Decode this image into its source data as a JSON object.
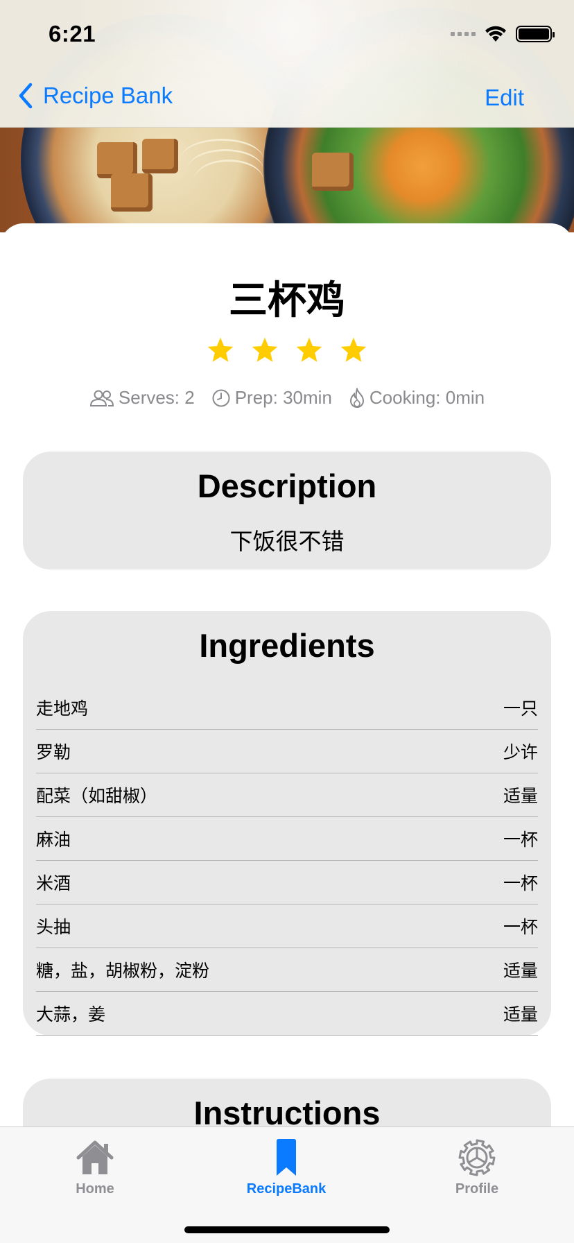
{
  "status_bar": {
    "time": "6:21"
  },
  "nav": {
    "back_label": "Recipe Bank",
    "edit_label": "Edit"
  },
  "recipe": {
    "title": "三杯鸡",
    "rating": 4,
    "rating_max": 4,
    "serves": "Serves: 2",
    "prep": "Prep: 30min",
    "cooking": "Cooking: 0min"
  },
  "description": {
    "heading": "Description",
    "text": "下饭很不错"
  },
  "ingredients": {
    "heading": "Ingredients",
    "items": [
      {
        "name": "走地鸡",
        "amount": "一只"
      },
      {
        "name": "罗勒",
        "amount": "少许"
      },
      {
        "name": "配菜（如甜椒）",
        "amount": "适量"
      },
      {
        "name": "麻油",
        "amount": "一杯"
      },
      {
        "name": "米酒",
        "amount": "一杯"
      },
      {
        "name": "头抽",
        "amount": "一杯"
      },
      {
        "name": "糖，盐，胡椒粉，淀粉",
        "amount": "适量"
      },
      {
        "name": "大蒜，姜",
        "amount": "适量"
      }
    ]
  },
  "instructions": {
    "heading": "Instructions"
  },
  "tabbar": {
    "home": "Home",
    "recipebank": "RecipeBank",
    "profile": "Profile",
    "active": "RecipeBank"
  },
  "colors": {
    "accent": "#0a7aff",
    "star": "#ffcc00",
    "card": "#e8e8e8",
    "muted": "#8a8a8e"
  },
  "icons": {
    "back": "chevron-left-icon",
    "serves": "people-icon",
    "prep": "clock-icon",
    "cooking": "flame-icon",
    "home": "house-icon",
    "recipebank": "bookmark-icon",
    "profile": "gear-icon"
  }
}
